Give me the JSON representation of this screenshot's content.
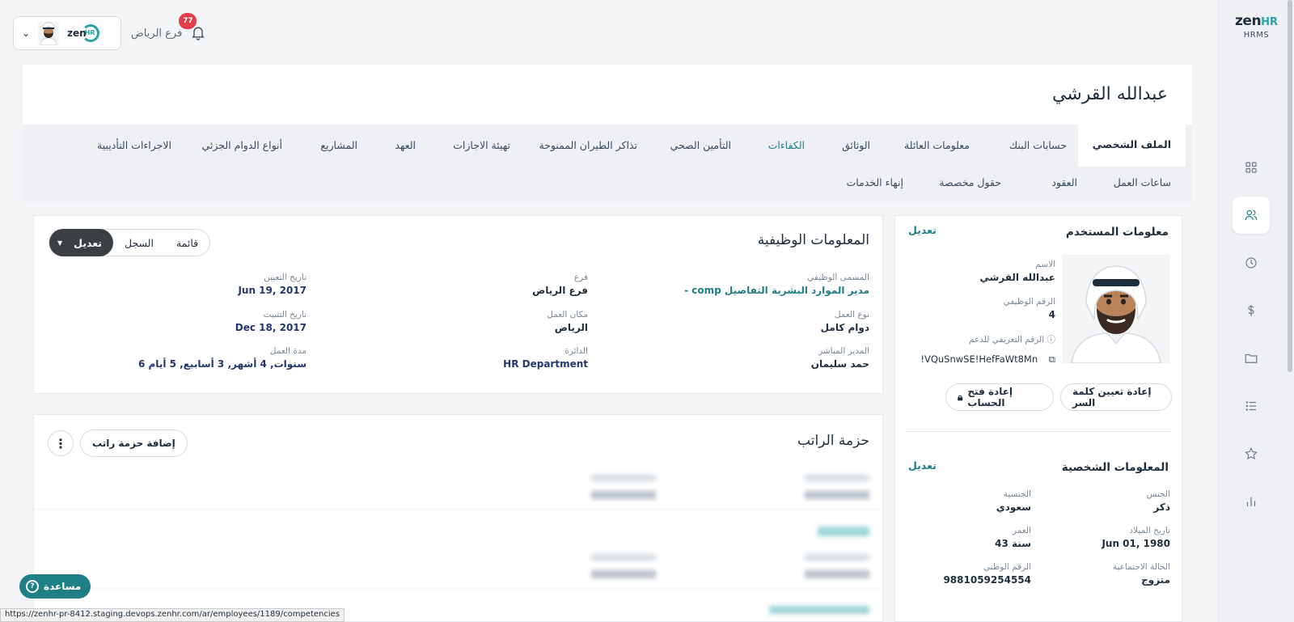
{
  "rail": {
    "logo_zen": "zen",
    "logo_hr": "HR",
    "logo_sub": "HRMS",
    "icons": [
      "grid-icon",
      "users-icon",
      "clock-icon",
      "dollar-icon",
      "folder-icon",
      "list-icon",
      "star-icon",
      "bar-chart-icon"
    ],
    "active": "users-icon"
  },
  "topbar": {
    "branch": "فرع الرياض",
    "notifications_count": "77",
    "mini_logo": "zen",
    "mini_logo_hr": "HR"
  },
  "header": {
    "employee_name": "عبدالله القرشي"
  },
  "tabs_row1": [
    "الملف الشخصي",
    "حسابات البنك",
    "معلومات العائلة",
    "الوثائق",
    "الكفاءات",
    "التأمين الصحي",
    "تذاكر الطيران الممنوحة",
    "تهيئة الاجازات",
    "العهد",
    "المشاريع",
    "أنواع الدوام الجزئي",
    "الاجراءات التأديبية"
  ],
  "tabs_row2": [
    "ساعات العمل",
    "العقود",
    "حقول مخصصة",
    "إنهاء الخدمات"
  ],
  "user_info": {
    "title": "معلومات المستخدم",
    "edit": "تعديل",
    "name_label": "الاسم",
    "name_value": "عبدالله القرشي",
    "emp_no_label": "الرقم الوظيفي",
    "emp_no_value": "4",
    "support_id_label": "الرقم التعريفي للدعم",
    "support_id_value": "!VQuSnwSE!HefFaWt8Mn",
    "reset_password": "إعادة تعيين كلمة السر",
    "unlock_account": "إعادة فتح الحساب"
  },
  "personal_info": {
    "title": "المعلومات الشخصية",
    "edit": "تعديل",
    "gender_label": "الجنس",
    "gender_value": "ذكر",
    "nationality_label": "الجنسية",
    "nationality_value": "سعودي",
    "dob_label": "تاريخ الميلاد",
    "dob_value": "Jun 01, 1980",
    "age_label": "العمر",
    "age_value": "43 سنة",
    "marital_label": "الحالة الاجتماعية",
    "marital_value": "متزوج",
    "national_id_label": "الرقم الوطني",
    "national_id_value": "9881059254554"
  },
  "job_info": {
    "title": "المعلومات الوظيفية",
    "seg_list": "قائمة",
    "seg_log": "السجل",
    "seg_edit": "تعديل",
    "job_title_label": "المسمى الوظيفي",
    "job_title_value": "- comp مدير الموارد البشرية التفاصيل",
    "branch_label": "فرع",
    "branch_value": "فرع الرياض",
    "hire_date_label": "تاريخ التعيين",
    "hire_date_value": "Jun 19, 2017",
    "work_type_label": "نوع العمل",
    "work_type_value": "دوام كامل",
    "location_label": "مكان العمل",
    "location_value": "الرياض",
    "confirm_date_label": "تاريخ التثبيت",
    "confirm_date_value": "Dec 18, 2017",
    "manager_label": "المدير المباشر",
    "manager_value": "حمد سليمان",
    "department_label": "الدائرة",
    "department_value": "HR Department",
    "tenure_label": "مدة العمل",
    "tenure_value": "6 سنوات, 4 أشهر, 3 أسابيع, 5 أيام"
  },
  "salary": {
    "title": "حزمة الراتب",
    "add": "إضافة حزمة راتب"
  },
  "help": {
    "label": "مساعدة"
  },
  "status_url": "https://zenhr-pr-8412.staging.devops.zenhr.com/ar/employees/1189/competencies"
}
